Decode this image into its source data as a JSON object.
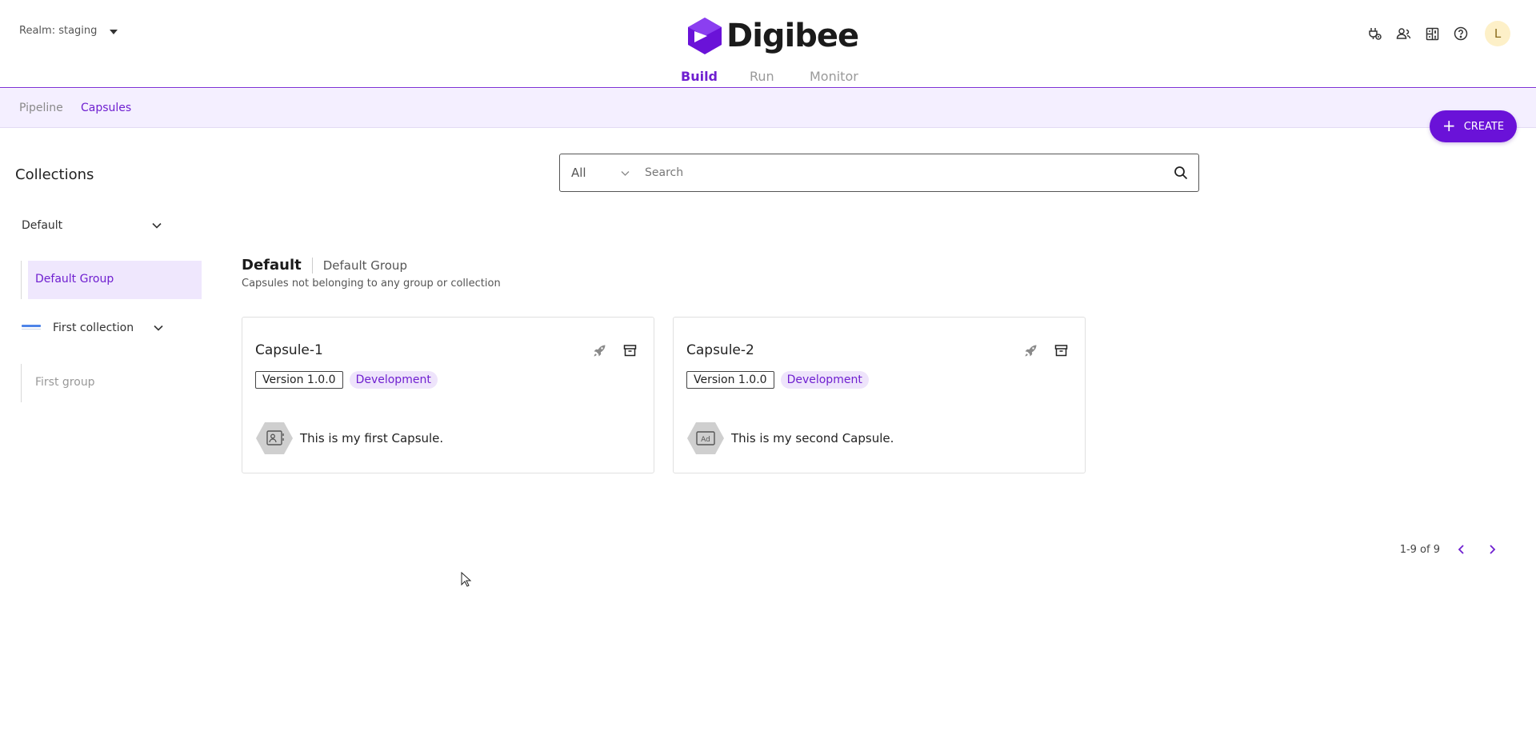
{
  "header": {
    "realm_label": "Realm: staging",
    "brand": "Digibee",
    "tabs": [
      "Build",
      "Run",
      "Monitor"
    ],
    "active_tab": "Build",
    "icons": [
      "plug-icon",
      "users-icon",
      "dashboard-icon",
      "help-icon"
    ],
    "avatar_initial": "L",
    "accent_color": "#6f1fd0"
  },
  "subnav": {
    "items": [
      "Pipeline",
      "Capsules"
    ],
    "active": "Capsules",
    "create_label": "CREATE"
  },
  "sidebar": {
    "title": "Collections",
    "collections": [
      {
        "label": "Default",
        "groups": [
          "Default Group"
        ],
        "selected_group": "Default Group"
      },
      {
        "label": "First collection",
        "groups": [
          "First group"
        ]
      }
    ]
  },
  "search": {
    "filter_value": "All",
    "placeholder": "Search"
  },
  "section": {
    "title": "Default",
    "group": "Default Group",
    "description": "Capsules not belonging to any group or collection"
  },
  "cards": [
    {
      "name": "Capsule-1",
      "version": "Version 1.0.0",
      "environment": "Development",
      "description": "This is my first Capsule.",
      "icon": "contact-card-icon"
    },
    {
      "name": "Capsule-2",
      "version": "Version 1.0.0",
      "environment": "Development",
      "description": "This is my second Capsule.",
      "icon": "ad-icon"
    }
  ],
  "pagination": {
    "range_text": "1-9 of 9"
  }
}
